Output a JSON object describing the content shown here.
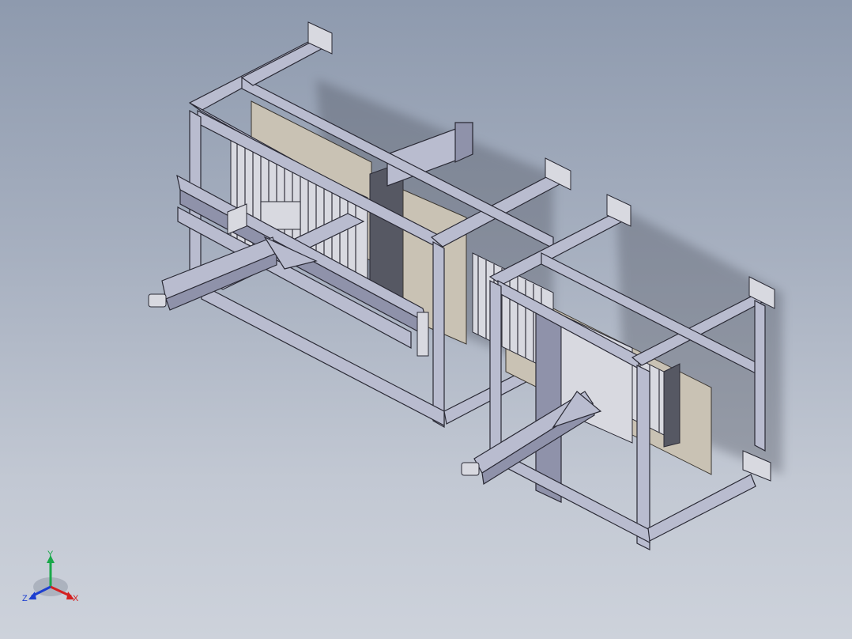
{
  "view": {
    "background_top": "#8e9aae",
    "background_bottom": "#cdd2db"
  },
  "triad": {
    "x_label": "X",
    "y_label": "Y",
    "z_label": "Z",
    "x_color": "#d42020",
    "y_color": "#1aa84a",
    "z_color": "#1d3fd0"
  },
  "model": {
    "description_icon": "machine-frame-assembly-icon"
  }
}
